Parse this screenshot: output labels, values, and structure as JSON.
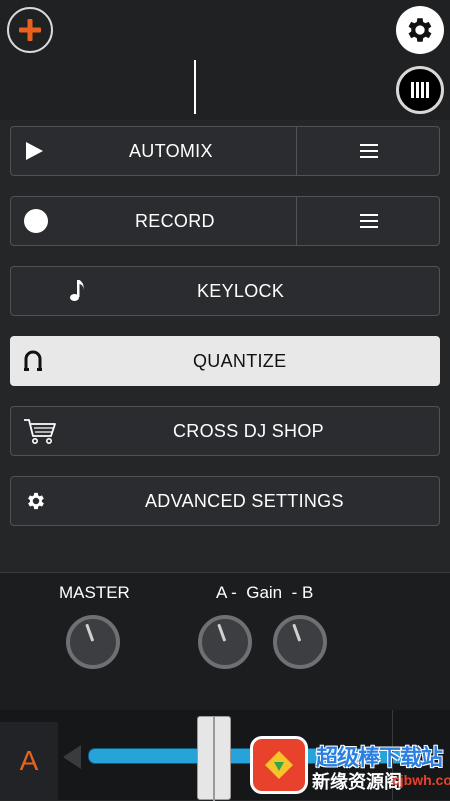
{
  "topbar": {
    "add_icon": "plus-icon",
    "settings_icon": "gear-icon",
    "deck_icon": "deck-bars-icon"
  },
  "menu": {
    "automix": {
      "label": "AUTOMIX",
      "icon": "play-icon",
      "list_icon": "hamburger-icon"
    },
    "record": {
      "label": "RECORD",
      "icon": "record-circle-icon",
      "list_icon": "hamburger-icon"
    },
    "keylock": {
      "label": "KEYLOCK",
      "icon": "music-note-icon"
    },
    "quantize": {
      "label": "QUANTIZE",
      "icon": "magnet-icon",
      "active": true
    },
    "shop": {
      "label": "CROSS DJ SHOP",
      "icon": "cart-icon"
    },
    "advanced": {
      "label": "ADVANCED SETTINGS",
      "icon": "gear-icon"
    }
  },
  "mixer": {
    "master_label": "MASTER",
    "gain_label": "A -  Gain  - B"
  },
  "crossfader": {
    "deck_label": "A",
    "position": 0.5
  },
  "watermark": {
    "line1": "超级棒下载站",
    "line2": "新缘资源阁",
    "url": "cjbwh.com"
  },
  "colors": {
    "accent_orange": "#e8621d",
    "fader_blue": "#26a4d9",
    "active_button": "#e8e8e8"
  }
}
